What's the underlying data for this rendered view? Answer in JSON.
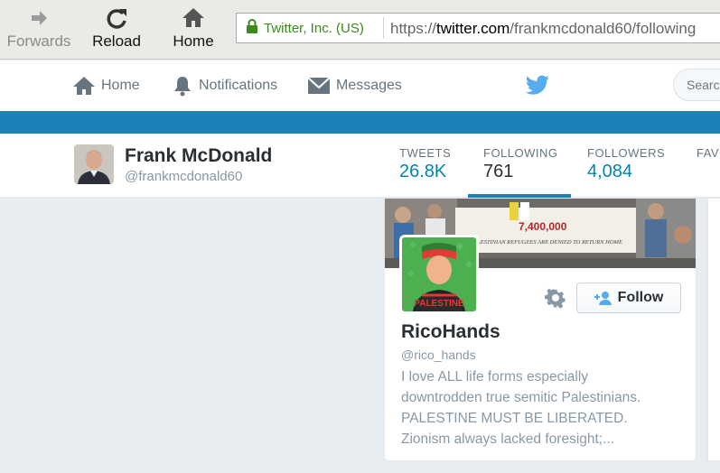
{
  "browser": {
    "forwards_label": "Forwards",
    "reload_label": "Reload",
    "home_label": "Home",
    "secure_org": "Twitter, Inc. (US)",
    "url_prefix": "https://",
    "url_domain": "twitter.com",
    "url_path": "/frankmcdonald60/following"
  },
  "topnav": {
    "home": "Home",
    "notifications": "Notifications",
    "messages": "Messages",
    "search_placeholder": "Search"
  },
  "profile": {
    "name": "Frank McDonald",
    "handle": "@frankmcdonald60",
    "stats": [
      {
        "label": "TWEETS",
        "value": "26.8K"
      },
      {
        "label": "FOLLOWING",
        "value": "761"
      },
      {
        "label": "FOLLOWERS",
        "value": "4,084"
      },
      {
        "label": "FAV",
        "value": ""
      }
    ]
  },
  "card": {
    "name": "RicoHands",
    "handle": "@rico_hands",
    "follow_label": "Follow",
    "bio": "I love ALL life forms especially downtrodden true semitic Palestinians. PALESTINE MUST BE LIBERATED. Zionism always lacked foresight;...",
    "banner_sign_number": "7,400,000",
    "banner_sign_text": "PALESTINIAN REFUGEES ARE DENIED TO RETURN HOME",
    "avatar_text": "PALESTINE"
  },
  "colors": {
    "twitter_blue": "#1b82b8",
    "link_blue": "#0084b4",
    "secure_green": "#3a8a1e"
  }
}
